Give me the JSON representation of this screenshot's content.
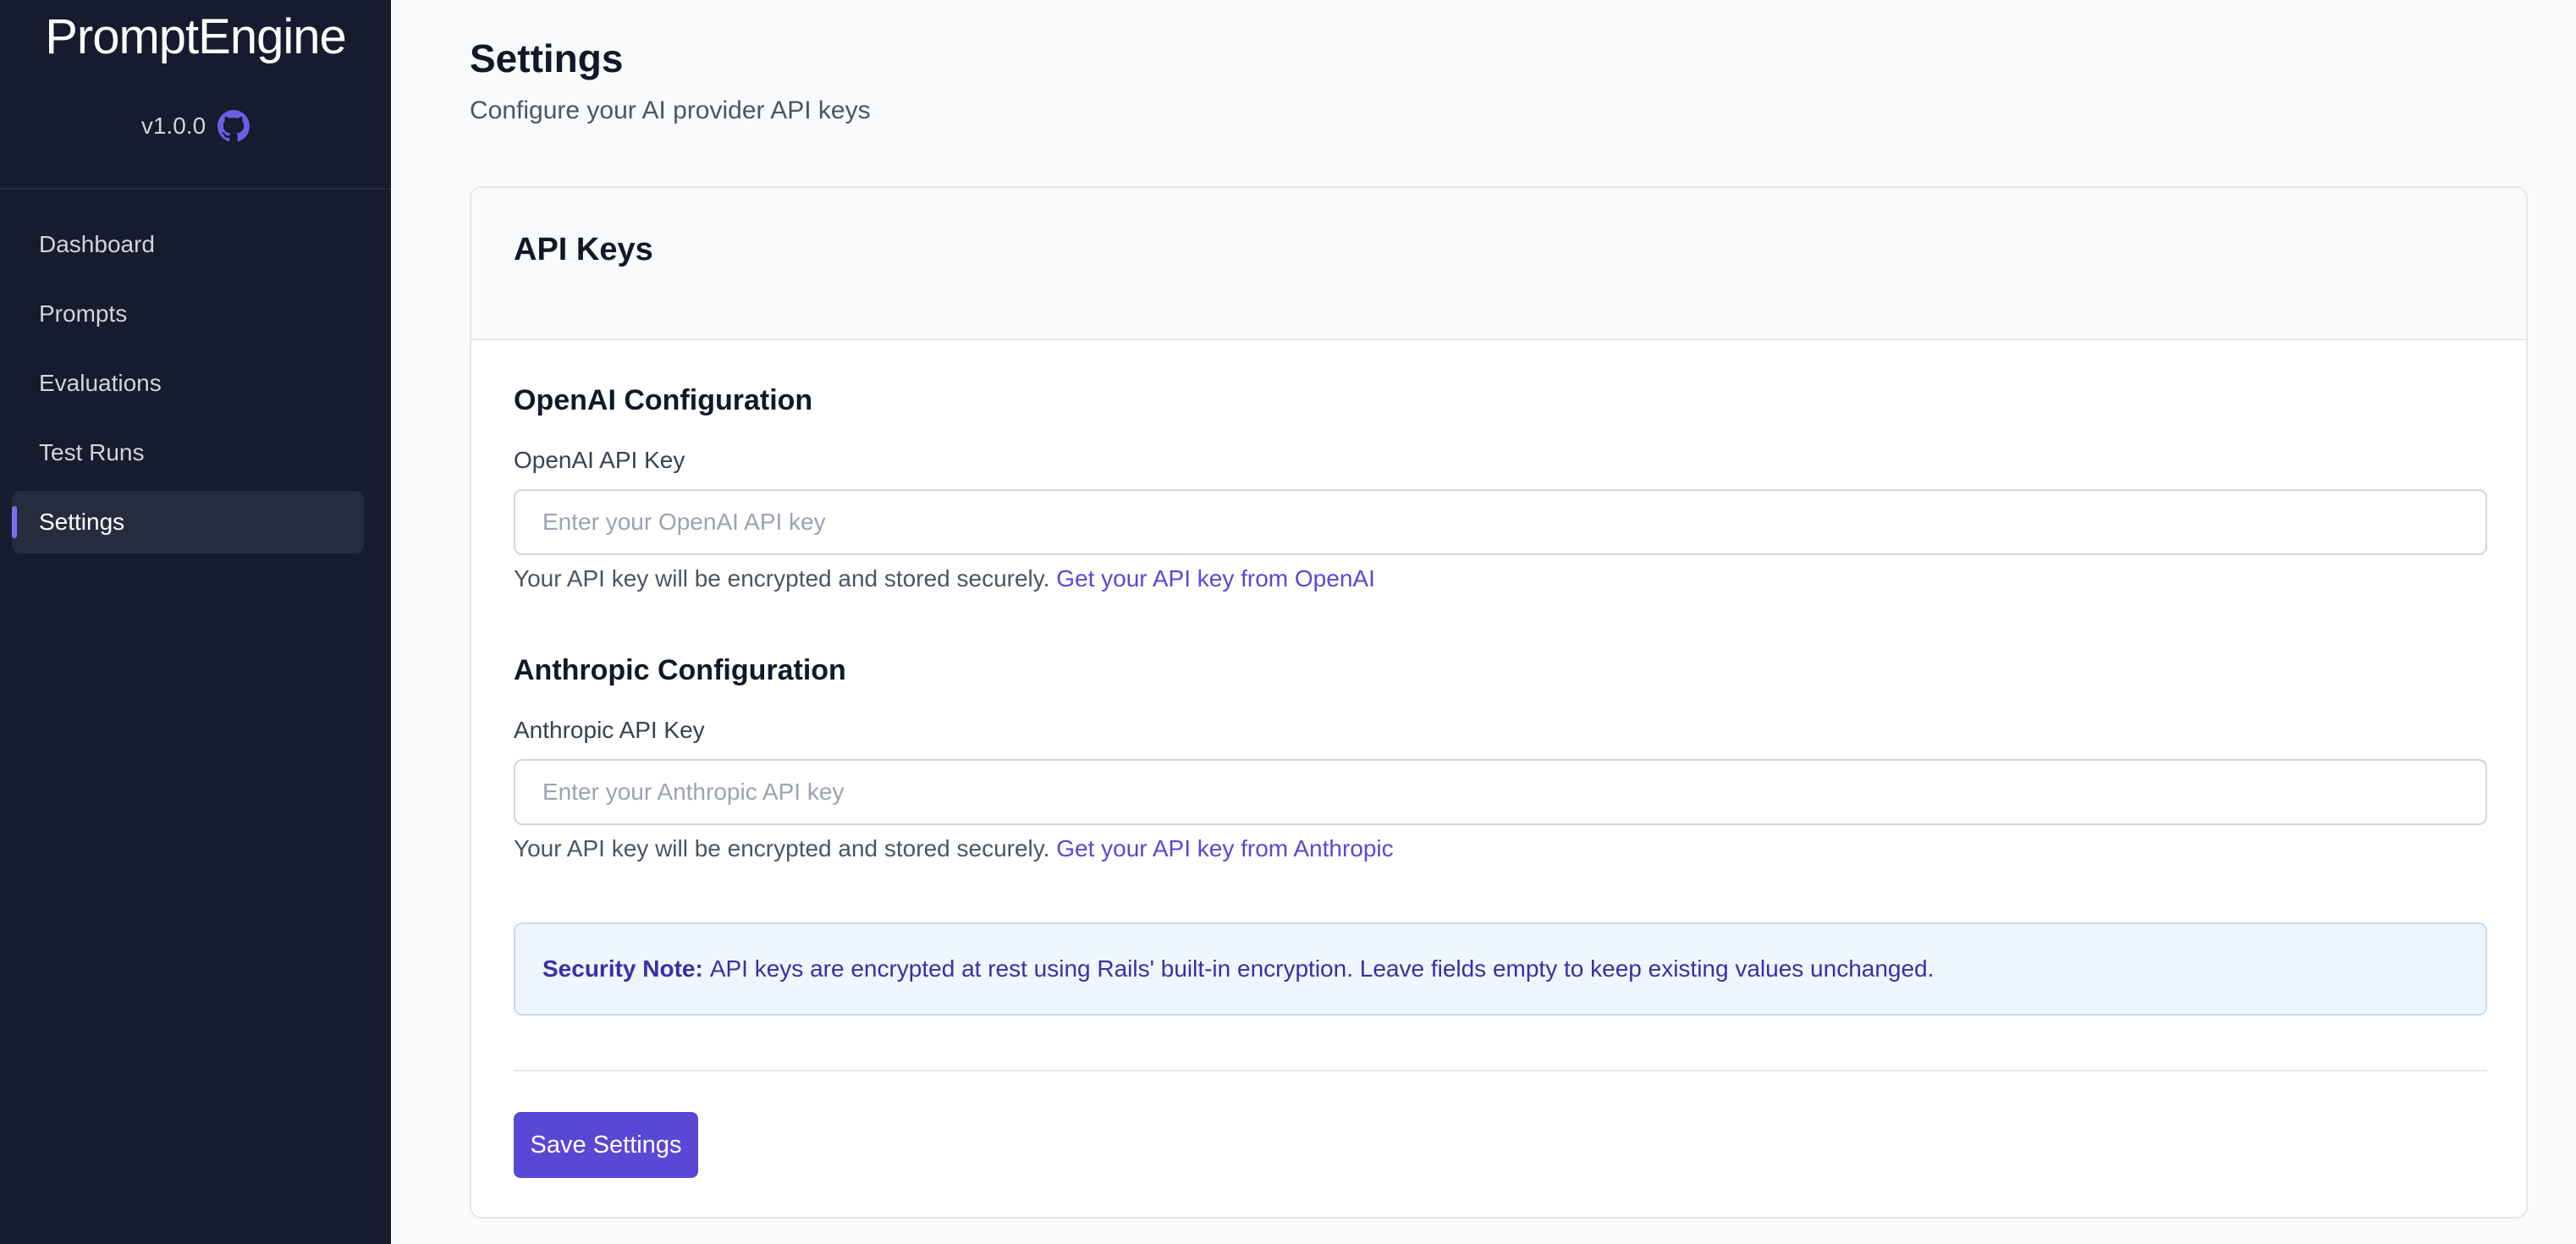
{
  "sidebar": {
    "brand": "PromptEngine",
    "version": "v1.0.0",
    "github_icon": "github-icon",
    "items": [
      {
        "label": "Dashboard",
        "active": false
      },
      {
        "label": "Prompts",
        "active": false
      },
      {
        "label": "Evaluations",
        "active": false
      },
      {
        "label": "Test Runs",
        "active": false
      },
      {
        "label": "Settings",
        "active": true
      }
    ]
  },
  "header": {
    "title": "Settings",
    "subtitle": "Configure your AI provider API keys"
  },
  "card": {
    "title": "API Keys",
    "openai": {
      "section_title": "OpenAI Configuration",
      "label": "OpenAI API Key",
      "placeholder": "Enter your OpenAI API key",
      "value": "",
      "help_text": "Your API key will be encrypted and stored securely.",
      "link_text": "Get your API key from OpenAI"
    },
    "anthropic": {
      "section_title": "Anthropic Configuration",
      "label": "Anthropic API Key",
      "placeholder": "Enter your Anthropic API key",
      "value": "",
      "help_text": "Your API key will be encrypted and stored securely.",
      "link_text": "Get your API key from Anthropic"
    },
    "security_note": {
      "label": "Security Note:",
      "text": "API keys are encrypted at rest using Rails' built-in encryption. Leave fields empty to keep existing values unchanged."
    },
    "save_label": "Save Settings"
  },
  "colors": {
    "sidebar_bg": "#161b2d",
    "accent": "#5b47d6",
    "active_indicator": "#7c6cf2",
    "note_bg": "#eff6ff",
    "note_text": "#3730a3"
  }
}
